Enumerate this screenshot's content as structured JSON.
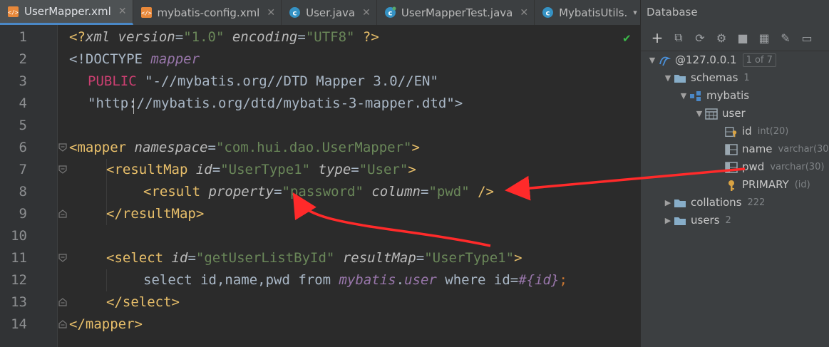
{
  "tabs": [
    {
      "label": "UserMapper.xml",
      "icon": "xml-file-icon",
      "active": true
    },
    {
      "label": "mybatis-config.xml",
      "icon": "xml-file-icon",
      "active": false
    },
    {
      "label": "User.java",
      "icon": "java-class-icon",
      "active": false
    },
    {
      "label": "UserMapperTest.java",
      "icon": "java-test-class-icon",
      "active": false
    },
    {
      "label": "MybatisUtils.",
      "icon": "java-class-icon",
      "active": false
    }
  ],
  "line_numbers": [
    "1",
    "2",
    "3",
    "4",
    "5",
    "6",
    "7",
    "8",
    "9",
    "10",
    "11",
    "12",
    "13",
    "14"
  ],
  "code": {
    "l1": {
      "open": "<?",
      "name": "xml",
      "a1": "version",
      "eq1": "=",
      "v1": "\"1.0\"",
      "a2": "encoding",
      "eq2": "=",
      "v2": "\"UTF8\"",
      "close": "?>"
    },
    "l2": {
      "open": "<!DOCTYPE",
      "name": "mapper"
    },
    "l3": {
      "kw": "PUBLIC",
      "str": "\"-//mybatis.org//DTD Mapper 3.0//EN\""
    },
    "l4": {
      "str": "\"http://mybatis.org/dtd/mybatis-3-mapper.dtd\"",
      "close": ">"
    },
    "l6": {
      "open": "<",
      "tag": "mapper",
      "attr": "namespace",
      "eq": "=",
      "val": "\"com.hui.dao.UserMapper\"",
      "close": ">"
    },
    "l7": {
      "open": "<",
      "tag": "resultMap",
      "attr1": "id",
      "eq1": "=",
      "val1": "\"UserType1\"",
      "attr2": "type",
      "eq2": "=",
      "val2": "\"User\"",
      "close": ">"
    },
    "l8": {
      "open": "<",
      "tag": "result",
      "attr1": "property",
      "eq1": "=",
      "val1": "\"password\"",
      "attr2": "column",
      "eq2": "=",
      "val2": "\"pwd\"",
      "close": "/>"
    },
    "l9": {
      "open": "</",
      "tag": "resultMap",
      "close": ">"
    },
    "l11": {
      "open": "<",
      "tag": "select",
      "attr1": "id",
      "eq1": "=",
      "val1": "\"getUserListById\"",
      "attr2": "resultMap",
      "eq2": "=",
      "val2": "\"UserType1\"",
      "close": ">"
    },
    "l12": {
      "t1": "select id,name,pwd from ",
      "schema": "mybatis",
      "dot": ".",
      "table": "user",
      "t2": " where id=",
      "param": "#{id}",
      "semi": ";"
    },
    "l13": {
      "open": "</",
      "tag": "select",
      "close": ">"
    },
    "l14": {
      "open": "</",
      "tag": "mapper",
      "close": ">"
    }
  },
  "database": {
    "title": "Database",
    "host": "@127.0.0.1",
    "host_badge": "1 of 7",
    "schemas_label": "schemas",
    "schemas_count": "1",
    "schema": "mybatis",
    "table": "user",
    "columns": [
      {
        "name": "id",
        "type": "int(20)",
        "icon": "primary-key-column-icon"
      },
      {
        "name": "name",
        "type": "varchar(30",
        "icon": "column-icon"
      },
      {
        "name": "pwd",
        "type": "varchar(30)",
        "icon": "column-icon"
      }
    ],
    "key": {
      "name": "PRIMARY",
      "type": "(id)",
      "icon": "key-icon"
    },
    "collations_label": "collations",
    "collations_count": "222",
    "users_label": "users",
    "users_count": "2"
  },
  "colors": {
    "annotation_arrow": "#ff2a2a",
    "editor_bg": "#2b2b2b",
    "panel_bg": "#3c3f41"
  }
}
